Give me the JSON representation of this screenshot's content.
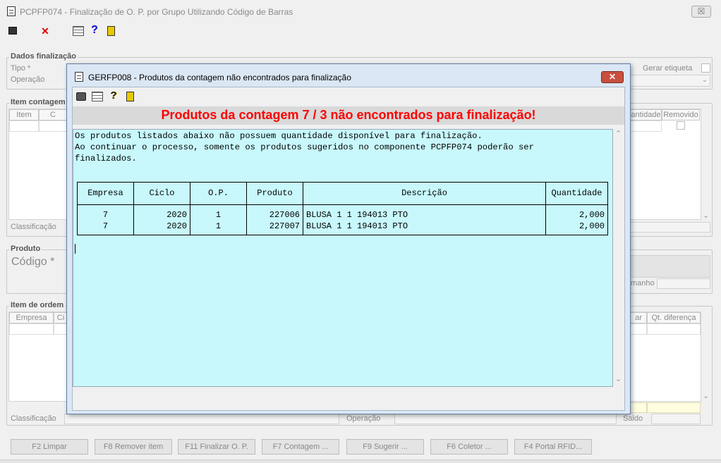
{
  "main_window": {
    "title": "PCPFP074 - Finalização de O. P.  por Grupo Utilizando Código de Barras",
    "close_glyph": "☒",
    "toolbar": {
      "first_icon": "window-icon",
      "cancel_glyph": "✕",
      "grid_icon": "grid-icon",
      "help_glyph": "?",
      "exit_icon": "door-exit-icon"
    },
    "dados_finalizacao": {
      "label": "Dados finalização",
      "tipo_label": "Tipo *",
      "operacao_label": "Operação",
      "gerar_etiqueta_label": "Gerar etiqueta"
    },
    "item_contagem": {
      "label": "Item contagem",
      "columns": [
        "Item",
        "C",
        "antidade",
        "Removido"
      ],
      "classificacao_label": "Classificação"
    },
    "produto": {
      "label": "Produto",
      "codigo_label": "Código *",
      "tamanho_label": "manho"
    },
    "item_ordem": {
      "label": "Item de ordem",
      "columns": [
        "Empresa",
        "Ci",
        "ar",
        "Qt. diferença"
      ],
      "classificacao_label": "Classificação",
      "operacao_label": "Operação",
      "saldo_label": "Saldo"
    },
    "buttons": [
      "F2 Limpar",
      "F8 Remover item",
      "F11 Finalizar O. P.",
      "F7 Contagem ...",
      "F9 Sugerir ...",
      "F6 Coletor ...",
      "F4 Portal RFID..."
    ]
  },
  "dialog": {
    "title": "GERFP008 - Produtos da contagem não encontrados para finalização",
    "close_glyph": "✕",
    "toolbar": {
      "print_icon": "printer-icon",
      "grid_icon": "grid-icon",
      "help_glyph": "?",
      "exit_icon": "door-exit-icon"
    },
    "heading": "Produtos da contagem 7 / 3 não encontrados para finalização!",
    "message_lines": [
      "Os produtos listados abaixo não possuem quantidade disponível para finalização.",
      "Ao continuar o processo, somente os produtos sugeridos no componente PCPFP074 poderão ser",
      "finalizados."
    ],
    "table": {
      "headers": [
        "Empresa",
        "Ciclo",
        "O.P.",
        "Produto",
        "Descrição",
        "Quantidade"
      ],
      "rows": [
        [
          "7",
          "2020",
          "1",
          "227006",
          "BLUSA 1 1 194013 PTO",
          "2,000"
        ],
        [
          "7",
          "2020",
          "1",
          "227007",
          "BLUSA 1 1 194013 PTO",
          "2,000"
        ]
      ]
    }
  }
}
